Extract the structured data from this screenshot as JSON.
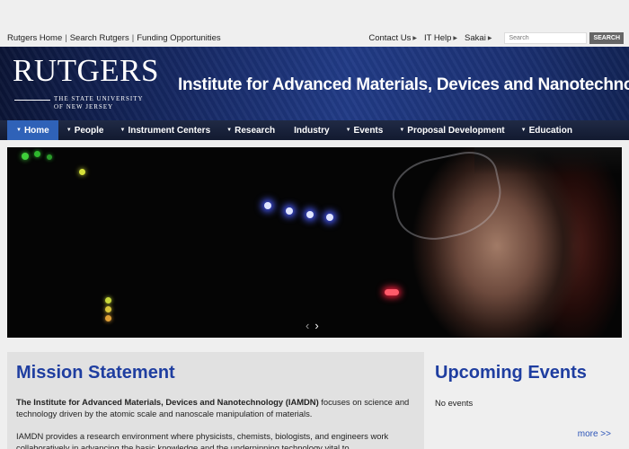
{
  "utility": {
    "left_links": [
      "Rutgers Home",
      "Search Rutgers",
      "Funding Opportunities"
    ],
    "separator": "|",
    "right_links": [
      "Contact Us",
      "IT Help",
      "Sakai"
    ],
    "search_placeholder": "Search",
    "search_button": "SEARCH"
  },
  "header": {
    "logo_word": "RUTGERS",
    "logo_sub1": "THE STATE UNIVERSITY",
    "logo_sub2": "OF NEW JERSEY",
    "title": "Institute for Advanced Materials, Devices and Nanotechnology"
  },
  "nav": {
    "items": [
      {
        "label": "Home",
        "dropdown": true,
        "active": true
      },
      {
        "label": "People",
        "dropdown": true
      },
      {
        "label": "Instrument Centers",
        "dropdown": true
      },
      {
        "label": "Research",
        "dropdown": true
      },
      {
        "label": "Industry",
        "dropdown": false
      },
      {
        "label": "Events",
        "dropdown": true
      },
      {
        "label": "Proposal Development",
        "dropdown": true
      },
      {
        "label": "Education",
        "dropdown": true
      }
    ]
  },
  "hero": {
    "prev_glyph": "‹",
    "next_glyph": "›"
  },
  "mission": {
    "title": "Mission Statement",
    "p1_bold": "The Institute for Advanced Materials, Devices and Nanotechnology (IAMDN)",
    "p1_rest": " focuses on science and technology driven by the atomic scale and nanoscale manipulation of materials.",
    "p2": "IAMDN provides a research environment where physicists, chemists, biologists, and engineers work collaboratively in advancing the basic knowledge and the underpinning technology vital to"
  },
  "events": {
    "title": "Upcoming Events",
    "empty_text": "No events",
    "more_link": "more >>"
  },
  "colors": {
    "nav_active": "#2f62b8",
    "heading_blue": "#1f3ea0",
    "link_blue": "#2c55b8"
  }
}
